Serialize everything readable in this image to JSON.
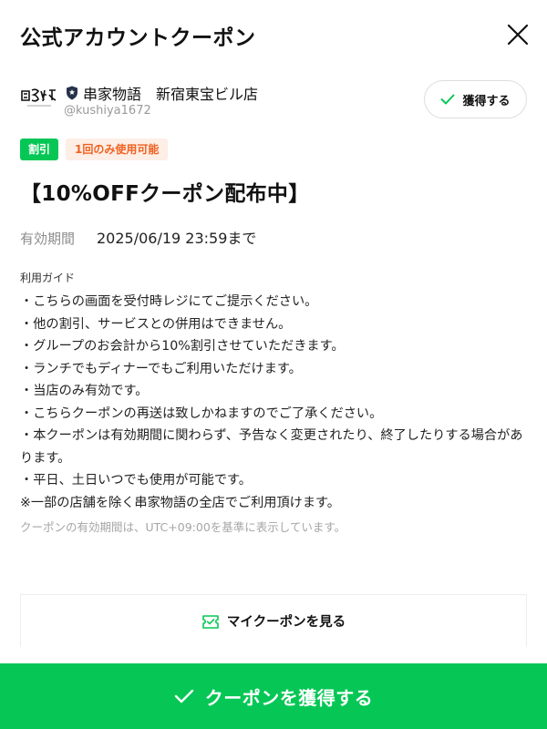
{
  "header": {
    "title": "公式アカウントクーポン",
    "close_icon": "close-icon"
  },
  "shop": {
    "logo_text": "串家物語",
    "verified_icon": "shield-badge-icon",
    "name": "串家物語　新宿東宝ビル店",
    "handle": "@kushiya1672",
    "follow_label": "獲得する"
  },
  "tags": {
    "type": "割引",
    "usage": "1回のみ使用可能"
  },
  "coupon": {
    "title": "【10%OFFクーポン配布中】",
    "validity_label": "有効期間",
    "validity_value": "2025/06/19 23:59まで"
  },
  "guide": {
    "label": "利用ガイド",
    "lines": [
      "・こちらの画面を受付時レジにてご提示ください。",
      "・他の割引、サービスとの併用はできません。",
      "・グループのお会計から10%割引させていただきます。",
      "・ランチでもディナーでもご利用いただけます。",
      "・当店のみ有効です。",
      "・こちらクーポンの再送は致しかねますのでご了承ください。",
      "・本クーポンは有効期間に関わらず、予告なく変更されたり、終了したりする場合があります。",
      "・平日、土日いつでも使用が可能です。",
      "※一部の店舗を除く串家物語の全店でご利用頂けます。"
    ],
    "timezone_note": "クーポンの有効期間は、UTC+09:00を基準に表示しています。"
  },
  "my_coupon": {
    "label": "マイクーポンを見る",
    "icon": "ticket-icon"
  },
  "cta": {
    "label": "クーポンを獲得する",
    "icon": "check-icon"
  },
  "colors": {
    "line_green": "#06c755",
    "tag_orange": "#f06120",
    "tag_orange_bg": "#fdeee6"
  }
}
